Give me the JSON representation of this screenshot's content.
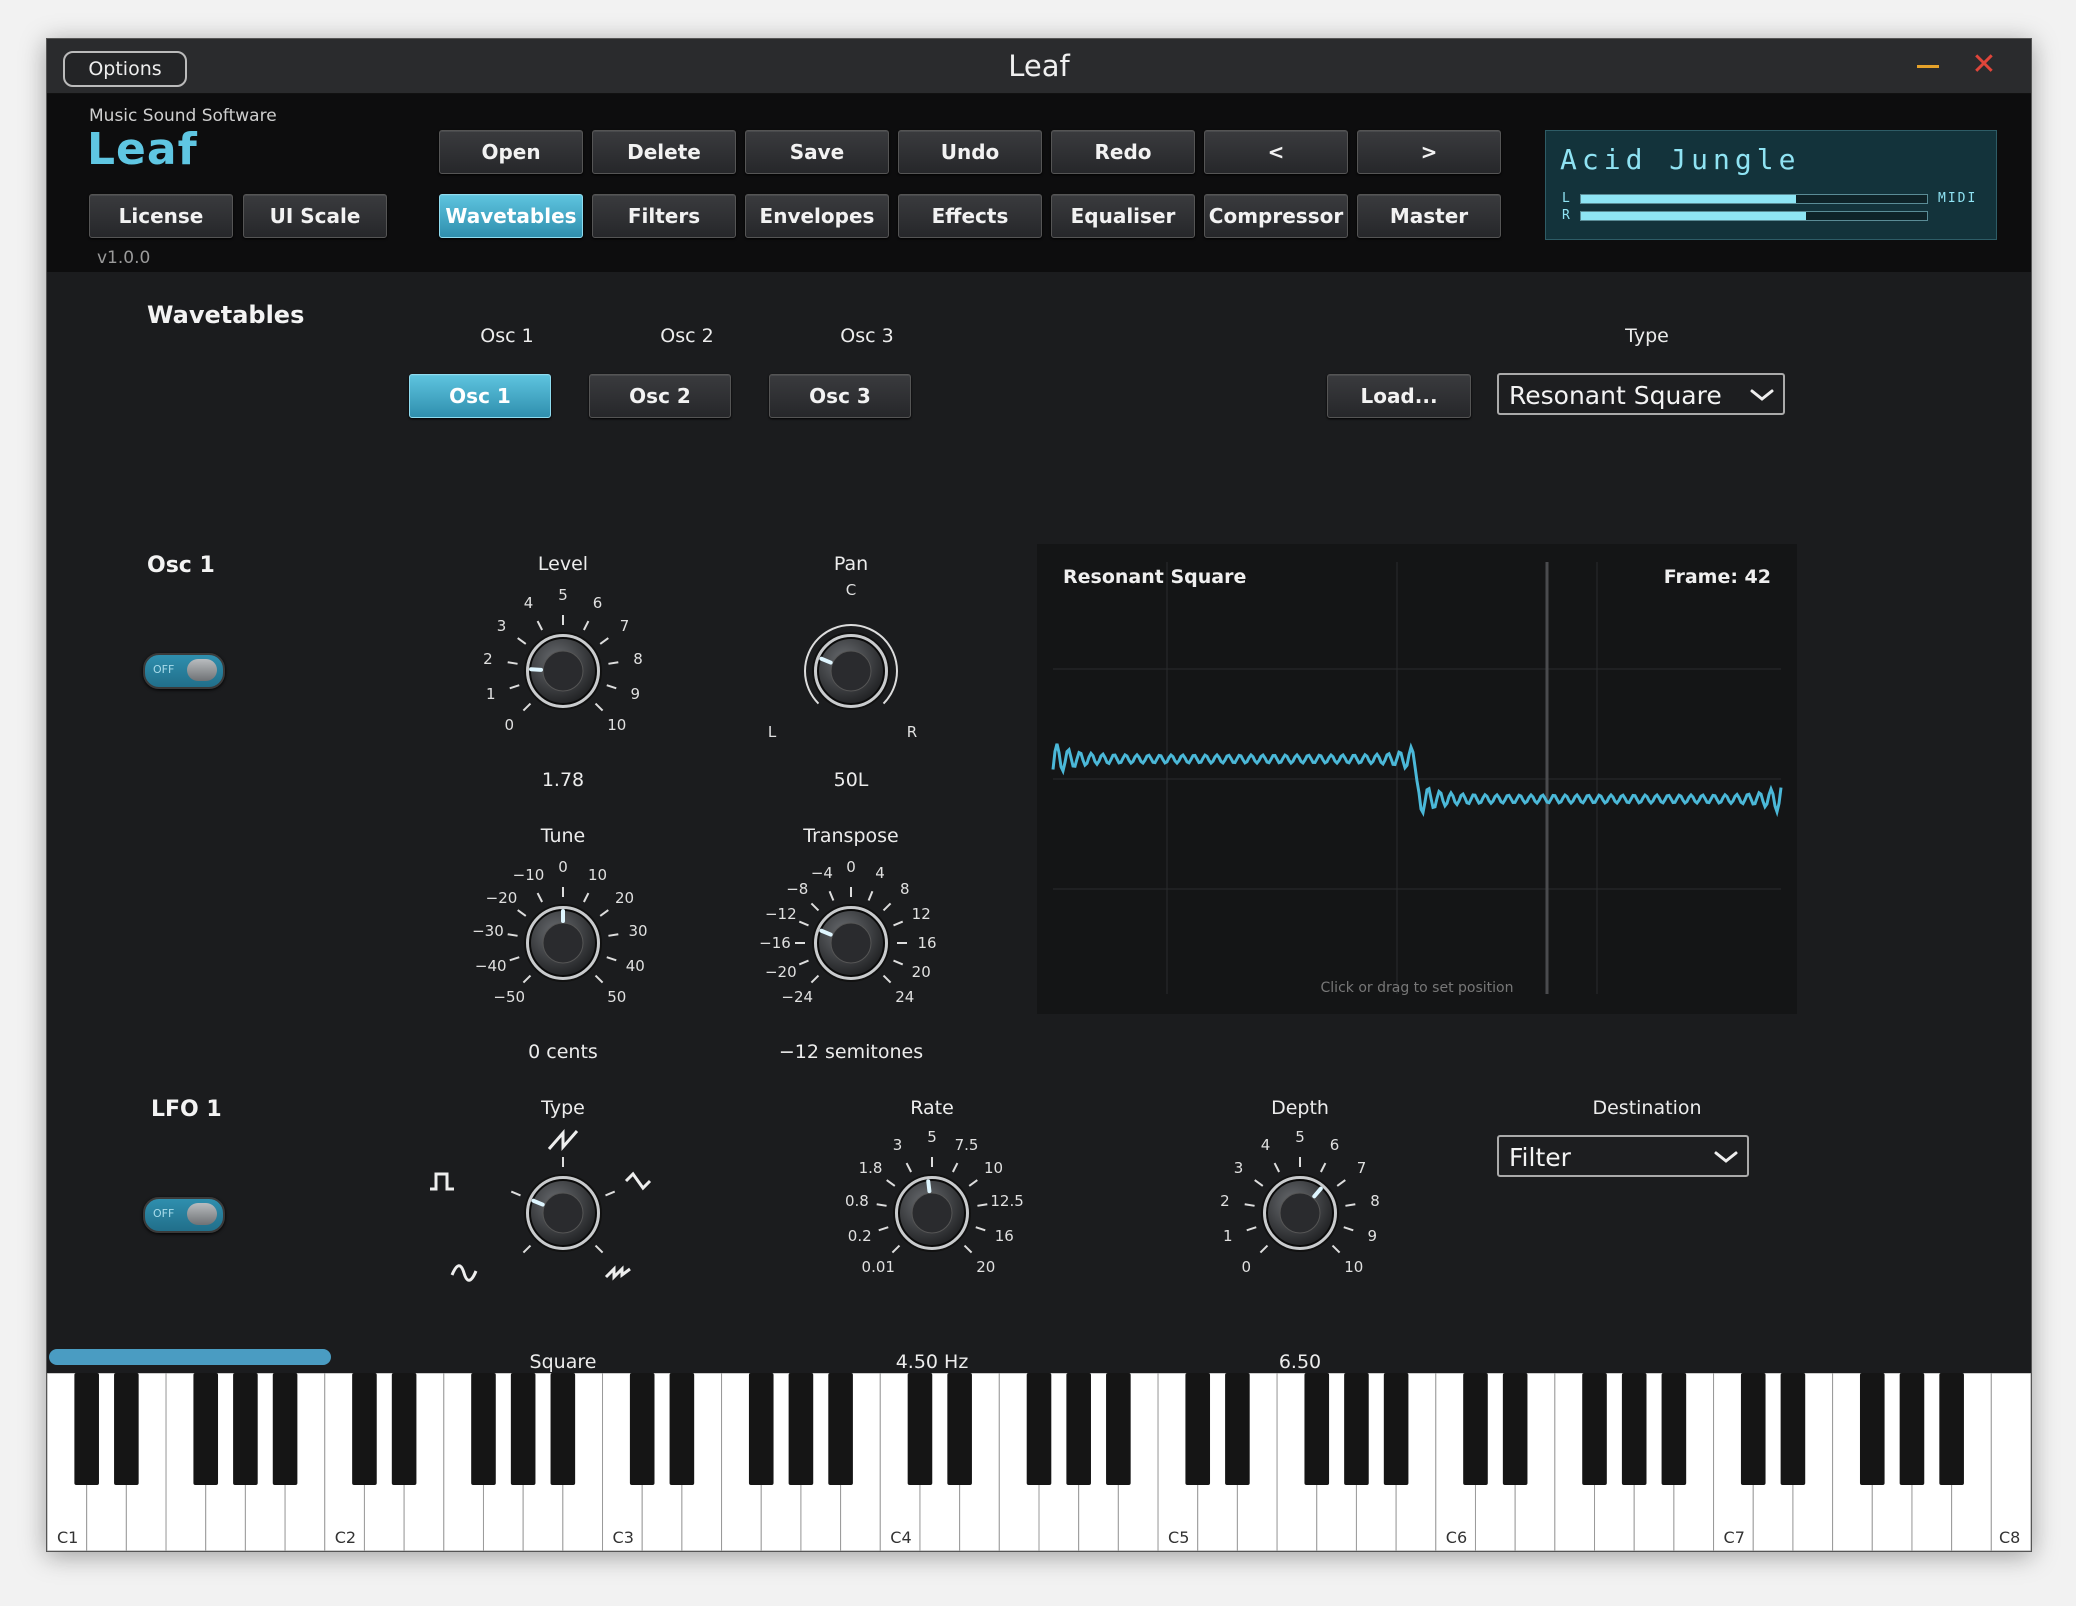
{
  "window": {
    "title": "Leaf",
    "options_label": "Options",
    "minimize_glyph": "—",
    "close_glyph": "✕"
  },
  "brand": {
    "company": "Music Sound Software",
    "logo": "Leaf",
    "version": "v1.0.0",
    "license_label": "License",
    "ui_scale_label": "UI Scale"
  },
  "toolbar": {
    "open": "Open",
    "delete": "Delete",
    "save": "Save",
    "undo": "Undo",
    "redo": "Redo",
    "prev": "<",
    "next": ">"
  },
  "tabs": {
    "wavetables": "Wavetables",
    "filters": "Filters",
    "envelopes": "Envelopes",
    "effects": "Effects",
    "equaliser": "Equaliser",
    "compressor": "Compressor",
    "master": "Master",
    "active": "wavetables"
  },
  "preset": {
    "name": "Acid Jungle",
    "left_channel": "L",
    "right_channel": "R",
    "midi_label": "MIDI",
    "level_left": 0.62,
    "level_right": 0.65
  },
  "wavetables": {
    "section_title": "Wavetables",
    "osc_headers": [
      "Osc 1",
      "Osc 2",
      "Osc 3"
    ],
    "osc_buttons": [
      "Osc 1",
      "Osc 2",
      "Osc 3"
    ],
    "active_osc": 0,
    "type_label": "Type",
    "load_label": "Load...",
    "type_value": "Resonant Square"
  },
  "osc1": {
    "section_title": "Osc 1",
    "toggle_label": "OFF",
    "level": {
      "label": "Level",
      "ticks": [
        "0",
        "1",
        "2",
        "3",
        "4",
        "5",
        "6",
        "7",
        "8",
        "9",
        "10"
      ],
      "value_text": "1.78",
      "value": 1.78
    },
    "pan": {
      "label": "Pan",
      "center": "C",
      "left": "L",
      "right": "R",
      "value_text": "50L",
      "value": -0.5
    },
    "tune": {
      "label": "Tune",
      "ticks": [
        "−50",
        "−40",
        "−30",
        "−20",
        "−10",
        "0",
        "10",
        "20",
        "30",
        "40",
        "50"
      ],
      "value_text": "0 cents",
      "value": 0
    },
    "transpose": {
      "label": "Transpose",
      "ticks": [
        "−24",
        "−20",
        "−16",
        "−12",
        "−8",
        "−4",
        "0",
        "4",
        "8",
        "12",
        "16",
        "20",
        "24"
      ],
      "value_text": "−12 semitones",
      "value": -12
    }
  },
  "wave_display": {
    "title": "Resonant Square",
    "frame_text": "Frame: 42",
    "hint": "Click or drag to set position",
    "wave_color": "#4bb8d8"
  },
  "lfo1": {
    "section_title": "LFO 1",
    "toggle_label": "OFF",
    "type": {
      "label": "Type",
      "value_text": "Square",
      "shapes": [
        "sine-wave-icon",
        "square-wave-icon",
        "sawtooth-up-icon",
        "triangle-wave-icon",
        "sawtooth-down-icon"
      ]
    },
    "rate": {
      "label": "Rate",
      "ticks": [
        "0.01",
        "0.2",
        "0.8",
        "1.8",
        "3",
        "5",
        "7.5",
        "10",
        "12.5",
        "16",
        "20"
      ],
      "value_text": "4.50 Hz",
      "value": 4.5
    },
    "depth": {
      "label": "Depth",
      "ticks": [
        "0",
        "1",
        "2",
        "3",
        "4",
        "5",
        "6",
        "7",
        "8",
        "9",
        "10"
      ],
      "value_text": "6.50",
      "value": 6.5
    },
    "destination_label": "Destination",
    "destination_value": "Filter"
  },
  "keyboard": {
    "octave_labels": [
      "C1",
      "C2",
      "C3",
      "C4",
      "C5",
      "C6",
      "C7",
      "C8"
    ]
  },
  "colors": {
    "accent": "#5ec4df",
    "lcd_text": "#8fe3f3",
    "close": "#e0453a",
    "minimize": "#e5a22a"
  }
}
